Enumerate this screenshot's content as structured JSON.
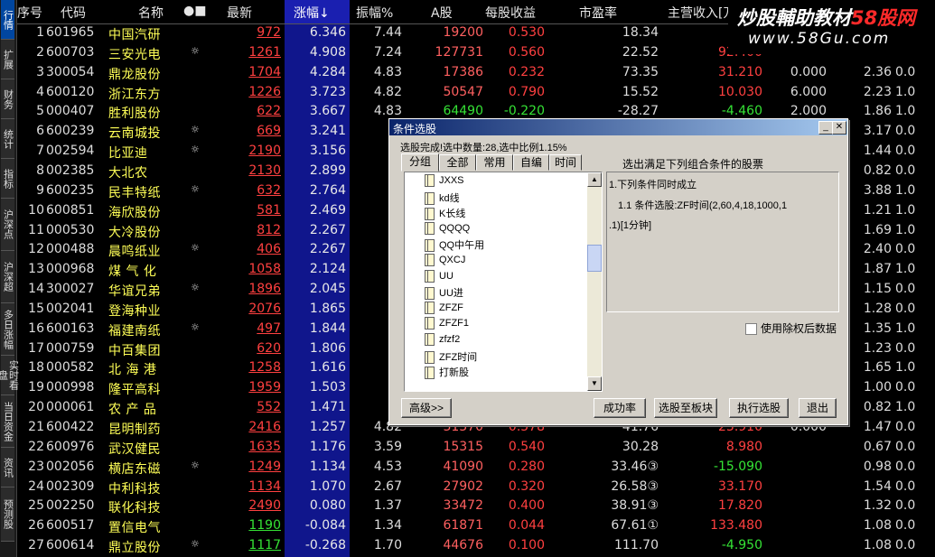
{
  "left_tabs": [
    "行情",
    "扩展",
    "财务",
    "统计",
    "指标",
    "沪深点",
    "沪深超",
    "多日涨幅",
    "实时看盘",
    "当日资金",
    "资讯",
    "预测股"
  ],
  "columns": [
    "序号",
    "代码",
    "名称",
    "●■",
    "最新",
    "涨幅↓",
    "振幅%",
    "A股",
    "每股收益",
    "市盈率",
    "主营收入[万"
  ],
  "rows": [
    {
      "no": "1",
      "code": "601965",
      "name": "中国汽研",
      "mk": "",
      "price": "972",
      "chg": "6.346",
      "amp": "7.44",
      "ash": "19200",
      "eps": "0.530",
      "pe": "18.34",
      "rev": "-4",
      "x": "",
      "y": "",
      "z": ""
    },
    {
      "no": "2",
      "code": "600703",
      "name": "三安光电",
      "mk": "☼",
      "price": "1261",
      "chg": "4.908",
      "amp": "7.24",
      "ash": "127731",
      "eps": "0.560",
      "pe": "22.52",
      "rev": "92.400",
      "x": "",
      "y": "",
      "z": ""
    },
    {
      "no": "3",
      "code": "300054",
      "name": "鼎龙股份",
      "mk": "",
      "price": "1704",
      "chg": "4.284",
      "amp": "4.83",
      "ash": "17386",
      "eps": "0.232",
      "pe": "73.35",
      "rev": "31.210",
      "x": "0.000",
      "y": "2.36",
      "z": "0.0"
    },
    {
      "no": "4",
      "code": "600120",
      "name": "浙江东方",
      "mk": "",
      "price": "1226",
      "chg": "3.723",
      "amp": "4.82",
      "ash": "50547",
      "eps": "0.790",
      "pe": "15.52",
      "rev": "10.030",
      "x": "6.000",
      "y": "2.23",
      "z": "1.0"
    },
    {
      "no": "5",
      "code": "000407",
      "name": "胜利股份",
      "mk": "",
      "price": "622",
      "chg": "3.667",
      "amp": "4.83",
      "ash": "64490",
      "eps": "-0.220",
      "pe": "-28.27",
      "rev": "-4.460",
      "x": "2.000",
      "y": "1.86",
      "z": "1.0"
    },
    {
      "no": "6",
      "code": "600239",
      "name": "云南城投",
      "mk": "☼",
      "price": "669",
      "chg": "3.241",
      "amp": "5.",
      "ash": "",
      "eps": "",
      "pe": "",
      "rev": "",
      "x": "",
      "y": "3.17",
      "z": "0.0"
    },
    {
      "no": "7",
      "code": "002594",
      "name": "比亚迪",
      "mk": "☼",
      "price": "2190",
      "chg": "3.156",
      "amp": "4.",
      "ash": "",
      "eps": "",
      "pe": "",
      "rev": "",
      "x": "",
      "y": "1.44",
      "z": "0.0"
    },
    {
      "no": "8",
      "code": "002385",
      "name": "大北农",
      "mk": "",
      "price": "2130",
      "chg": "2.899",
      "amp": "3.",
      "ash": "",
      "eps": "",
      "pe": "",
      "rev": "",
      "x": "",
      "y": "0.82",
      "z": "0.0"
    },
    {
      "no": "9",
      "code": "600235",
      "name": "民丰特纸",
      "mk": "☼",
      "price": "632",
      "chg": "2.764",
      "amp": "4.",
      "ash": "",
      "eps": "",
      "pe": "",
      "rev": "",
      "x": "",
      "y": "3.88",
      "z": "1.0"
    },
    {
      "no": "10",
      "code": "600851",
      "name": "海欣股份",
      "mk": "",
      "price": "581",
      "chg": "2.469",
      "amp": "6.",
      "ash": "",
      "eps": "",
      "pe": "",
      "rev": "",
      "x": "",
      "y": "1.21",
      "z": "1.0"
    },
    {
      "no": "11",
      "code": "000530",
      "name": "大冷股份",
      "mk": "",
      "price": "812",
      "chg": "2.267",
      "amp": "3.",
      "ash": "",
      "eps": "",
      "pe": "",
      "rev": "",
      "x": "",
      "y": "1.69",
      "z": "1.0"
    },
    {
      "no": "12",
      "code": "000488",
      "name": "晨鸣纸业",
      "mk": "☼",
      "price": "406",
      "chg": "2.267",
      "amp": "3.",
      "ash": "",
      "eps": "",
      "pe": "",
      "rev": "",
      "x": "",
      "y": "2.40",
      "z": "0.0"
    },
    {
      "no": "13",
      "code": "000968",
      "name": "煤 气 化",
      "mk": "",
      "price": "1058",
      "chg": "2.124",
      "amp": "4.",
      "ash": "",
      "eps": "",
      "pe": "",
      "rev": "",
      "x": "",
      "y": "1.87",
      "z": "1.0"
    },
    {
      "no": "14",
      "code": "300027",
      "name": "华谊兄弟",
      "mk": "☼",
      "price": "1896",
      "chg": "2.045",
      "amp": "3.",
      "ash": "",
      "eps": "",
      "pe": "",
      "rev": "",
      "x": "",
      "y": "1.15",
      "z": "0.0"
    },
    {
      "no": "15",
      "code": "002041",
      "name": "登海种业",
      "mk": "",
      "price": "2076",
      "chg": "1.865",
      "amp": "2.",
      "ash": "",
      "eps": "",
      "pe": "",
      "rev": "",
      "x": "",
      "y": "1.28",
      "z": "0.0"
    },
    {
      "no": "16",
      "code": "600163",
      "name": "福建南纸",
      "mk": "☼",
      "price": "497",
      "chg": "1.844",
      "amp": "4.",
      "ash": "",
      "eps": "",
      "pe": "",
      "rev": "",
      "x": "",
      "y": "1.35",
      "z": "1.0"
    },
    {
      "no": "17",
      "code": "000759",
      "name": "中百集团",
      "mk": "",
      "price": "620",
      "chg": "1.806",
      "amp": "3.",
      "ash": "",
      "eps": "",
      "pe": "",
      "rev": "",
      "x": "",
      "y": "1.23",
      "z": "0.0"
    },
    {
      "no": "18",
      "code": "000582",
      "name": "北 海 港",
      "mk": "",
      "price": "1258",
      "chg": "1.616",
      "amp": "3.",
      "ash": "",
      "eps": "",
      "pe": "",
      "rev": "",
      "x": "",
      "y": "1.65",
      "z": "1.0"
    },
    {
      "no": "19",
      "code": "000998",
      "name": "隆平高科",
      "mk": "",
      "price": "1959",
      "chg": "1.503",
      "amp": "2.",
      "ash": "",
      "eps": "",
      "pe": "",
      "rev": "",
      "x": "",
      "y": "1.00",
      "z": "0.0"
    },
    {
      "no": "20",
      "code": "000061",
      "name": "农 产 品",
      "mk": "",
      "price": "552",
      "chg": "1.471",
      "amp": "3.",
      "ash": "",
      "eps": "",
      "pe": "",
      "rev": "",
      "x": "",
      "y": "0.82",
      "z": "1.0"
    },
    {
      "no": "21",
      "code": "600422",
      "name": "昆明制药",
      "mk": "",
      "price": "2416",
      "chg": "1.257",
      "amp": "4.82",
      "ash": "31370",
      "eps": "0.578",
      "pe": "41.76",
      "rev": "23.910",
      "x": "0.000",
      "y": "1.47",
      "z": "0.0"
    },
    {
      "no": "22",
      "code": "600976",
      "name": "武汉健民",
      "mk": "",
      "price": "1635",
      "chg": "1.176",
      "amp": "3.59",
      "ash": "15315",
      "eps": "0.540",
      "pe": "30.28",
      "rev": "8.980",
      "x": "",
      "y": "0.67",
      "z": "0.0"
    },
    {
      "no": "23",
      "code": "002056",
      "name": "横店东磁",
      "mk": "☼",
      "price": "1249",
      "chg": "1.134",
      "amp": "4.53",
      "ash": "41090",
      "eps": "0.280",
      "pe": "33.46③",
      "rev": "-15.090",
      "x": "",
      "y": "0.98",
      "z": "0.0"
    },
    {
      "no": "24",
      "code": "002309",
      "name": "中利科技",
      "mk": "",
      "price": "1134",
      "chg": "1.070",
      "amp": "2.67",
      "ash": "27902",
      "eps": "0.320",
      "pe": "26.58③",
      "rev": "33.170",
      "x": "",
      "y": "1.54",
      "z": "0.0"
    },
    {
      "no": "25",
      "code": "002250",
      "name": "联化科技",
      "mk": "",
      "price": "2490",
      "chg": "0.080",
      "amp": "1.37",
      "ash": "33472",
      "eps": "0.400",
      "pe": "38.91③",
      "rev": "17.820",
      "x": "",
      "y": "1.32",
      "z": "0.0"
    },
    {
      "no": "26",
      "code": "600517",
      "name": "置信电气",
      "mk": "",
      "price": "1190",
      "chg": "-0.084",
      "amp": "1.34",
      "ash": "61871",
      "eps": "0.044",
      "pe": "67.61①",
      "rev": "133.480",
      "x": "",
      "y": "1.08",
      "z": "0.0"
    },
    {
      "no": "27",
      "code": "600614",
      "name": "鼎立股份",
      "mk": "☼",
      "price": "1117",
      "chg": "-0.268",
      "amp": "1.70",
      "ash": "44676",
      "eps": "0.100",
      "pe": "111.70",
      "rev": "-4.950",
      "x": "",
      "y": "1.08",
      "z": "0.0"
    }
  ],
  "watermark": {
    "line1_a": "炒股輔助教材",
    "line1_b": "58股网",
    "line2": "www.58Gu.com"
  },
  "dialog": {
    "title": "条件选股",
    "status": "选股完成!选中数量:28,选中比例1.15%",
    "tabs": [
      "分组",
      "全部",
      "常用",
      "自编",
      "时间"
    ],
    "tree_items": [
      "JXXS",
      "kd线",
      "K长线",
      "QQQQ",
      "QQ中午用",
      "QXCJ",
      "UU",
      "UU进",
      "ZFZF",
      "ZFZF1",
      "zfzf2",
      "ZFZ时间",
      "打新股"
    ],
    "cond_header": "选出满足下列组合条件的股票",
    "cond_lines": [
      "1.下列条件同时成立",
      "1.1 条件选股:ZF时间(2,60,4,18,1000,1",
      ".1)[1分钟]"
    ],
    "checkbox_label": "使用除权后数据",
    "buttons": {
      "advanced": "高级>>",
      "success_rate": "成功率",
      "to_block": "选股至板块",
      "execute": "执行选股",
      "exit": "退出"
    }
  }
}
